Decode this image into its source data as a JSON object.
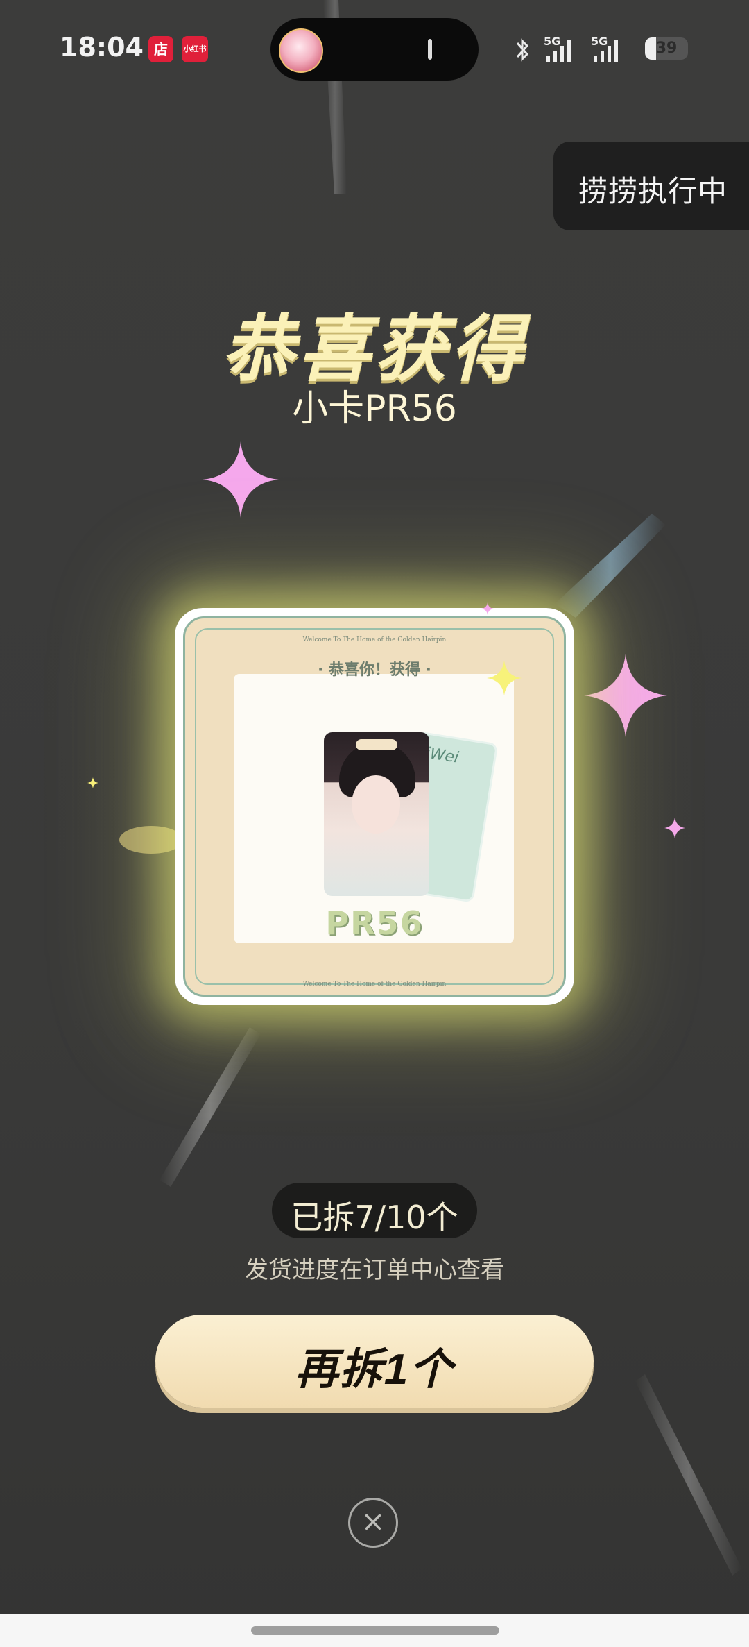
{
  "status_bar": {
    "time": "18:04",
    "app_badge_1": "店",
    "app_badge_2": "小红书",
    "signal_1": "5G",
    "signal_2": "5G",
    "battery": "39"
  },
  "floating_pill": {
    "label": "捞捞执行中"
  },
  "reward": {
    "headline": "恭喜获得",
    "prize_name": "小卡PR56"
  },
  "card": {
    "frame_caption": "Welcome To The Home of the Golden Hairpin",
    "congrats": "· 恭喜你！获得 ·",
    "back_card_text": "iWei",
    "code": "PR56"
  },
  "progress": {
    "count_text": "已拆7/10个",
    "hint": "发货进度在订单中心查看"
  },
  "actions": {
    "open_again": "再拆1个",
    "close_icon": "×"
  },
  "colors": {
    "background": "#3a3a39",
    "headline": "#fbf1b8",
    "button": "#f4e2bd",
    "card_glow": "#ecf078",
    "sparkle_pink": "#f5a8ec"
  }
}
